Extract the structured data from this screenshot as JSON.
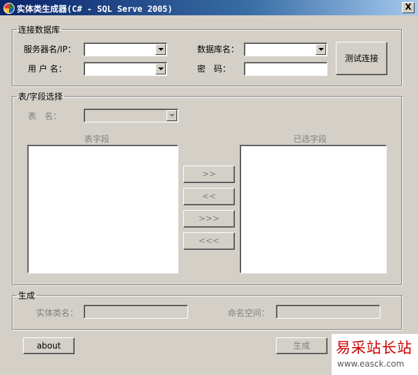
{
  "window": {
    "title": "实体类生成器(C# - SQL Serve 2005)",
    "close_label": "X"
  },
  "connect_group": {
    "legend": "连接数据库",
    "server_label": "服务器名/IP：",
    "user_label": "用 户 名：",
    "database_label": "数据库名：",
    "password_label": "密　码：",
    "server_value": "",
    "user_value": "",
    "database_value": "",
    "password_value": "",
    "test_button": "测试连接"
  },
  "table_group": {
    "legend": "表/字段选择",
    "table_label": "表　名：",
    "table_value": "",
    "fields_label": "表字段",
    "selected_label": "已选字段",
    "fields_items": [],
    "selected_items": [],
    "add_one": ">>",
    "remove_one": "<<",
    "add_all": ">>>",
    "remove_all": "<<<"
  },
  "generate_group": {
    "legend": "生成",
    "class_label": "实体类名：",
    "namespace_label": "命名空间：",
    "class_value": "",
    "namespace_value": ""
  },
  "footer": {
    "about_button": "about",
    "generate_button": "生成"
  },
  "watermark": {
    "text_cn": "易采站长站",
    "url": "www.easck.com"
  }
}
